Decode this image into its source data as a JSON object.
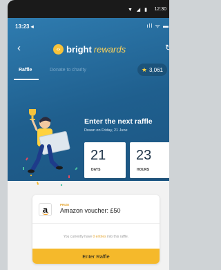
{
  "system_bar": {
    "time": "12:30",
    "icons": "▼ ◢ ▮"
  },
  "phone_status": {
    "time": "13:23 ◂",
    "icons": "ıll ᯤ ▬"
  },
  "header": {
    "brand_bright": "bright",
    "brand_rewards": "rewards",
    "back_icon": "‹",
    "refresh_icon": "↻"
  },
  "tabs": [
    {
      "label": "Raffle",
      "active": true
    },
    {
      "label": "Donate to charity",
      "active": false
    }
  ],
  "points": {
    "value": "3,061",
    "icon": "star-icon"
  },
  "raffle": {
    "title": "Enter the next raffle",
    "drawn": "Drawn on Friday, 21 June",
    "countdown": [
      {
        "value": "21",
        "unit": "DAYS"
      },
      {
        "value": "23",
        "unit": "HOURS"
      }
    ]
  },
  "prize": {
    "label": "PRIZE",
    "name": "Amazon voucher: £50",
    "logo_letter": "a",
    "entries_before": "You currently have ",
    "entries_count": "0 entries",
    "entries_after": " into this raffle.",
    "button_label": "Enter Raffle"
  },
  "colors": {
    "hero": "#1f5f8e",
    "accent": "#f5b92b",
    "tab_inactive": "#7ba8c9"
  }
}
